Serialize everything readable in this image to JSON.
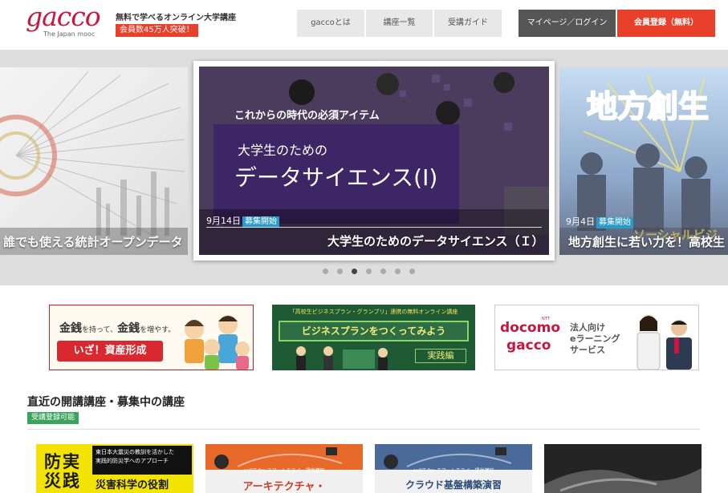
{
  "header": {
    "logo_text": "gacco",
    "logo_sub": "The Japan mooc",
    "tagline": "無料で学べるオンライン大学講座",
    "member_badge": "会員数45万人突破！",
    "nav": {
      "about": "gaccoとは",
      "courses": "講座一覧",
      "guide": "受講ガイド",
      "login": "マイページ／ログイン",
      "register": "会員登録（無料）"
    }
  },
  "carousel": {
    "active_index": 2,
    "dot_count": 7,
    "slides": [
      {
        "title": "誰でも使える統計オープンデータ"
      },
      {
        "date": "9月14日",
        "badge": "募集開始",
        "image_kicker": "これからの時代の必須アイテム",
        "image_subtitle": "大学生のための",
        "image_title": "データサイエンス(Ⅰ)",
        "title": "大学生のためのデータサイエンス（Ｉ）"
      },
      {
        "date": "9月4日",
        "badge": "募集開始",
        "image_title": "地方創生",
        "image_sub": "ソーシャルビジ",
        "title": "地方創生に若い力を！高校生"
      }
    ]
  },
  "banners": {
    "asset": {
      "headline_a": "金銭",
      "headline_b": "を持って、",
      "headline_c": "金銭",
      "headline_d": "を増やす。",
      "cta": "いざ！資産形成"
    },
    "biz": {
      "top": "「高校生ビジネスプラン・グランプリ」連携の無料オンライン講座",
      "main": "ビジネスプランをつくってみよう",
      "sub": "実践編"
    },
    "docomo": {
      "brand_a": "docomo",
      "brand_b": "gacco",
      "ntt": "NTT",
      "text_1": "法人向け",
      "text_2": "eラーニング",
      "text_3": "サービス"
    }
  },
  "section": {
    "title": "直近の開講講座・募集中の講座",
    "tag": "受講登録可能"
  },
  "cards": [
    {
      "big": "防実 災践",
      "note_1": "東日本大震災の教訓を活かした",
      "note_2": "実践的防災学へのアプローチ",
      "title": "災害科学の役割"
    },
    {
      "label": "enPiT-Pro スマートエスイー提供講座",
      "title": "アーキテクチャ・"
    },
    {
      "label": "enPiT-Pro スマートエスイー提供講座",
      "title": "クラウド基盤構築演習"
    },
    {
      "title": ""
    }
  ],
  "colors": {
    "brand": "#c8163e",
    "accent": "#e8402a",
    "nav_dark": "#555555",
    "green": "#3aa35d"
  }
}
